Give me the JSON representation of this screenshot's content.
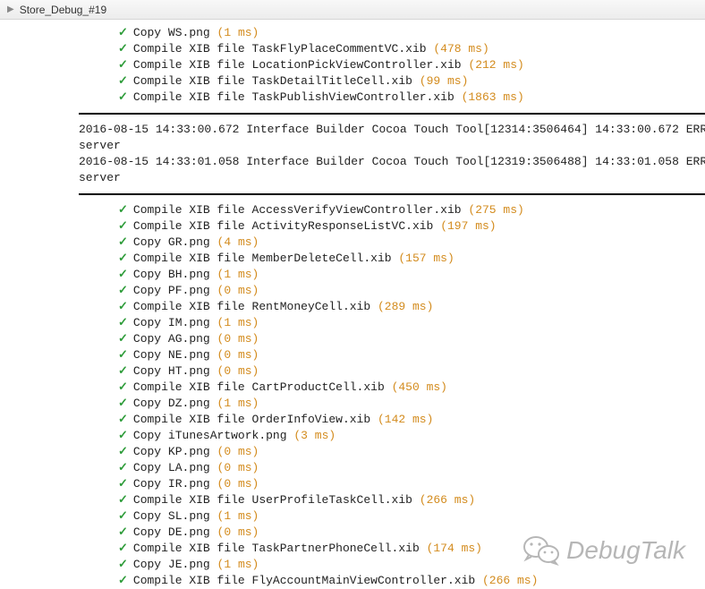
{
  "titlebar": {
    "title": "Store_Debug_#19"
  },
  "section1": [
    {
      "label": "Copy WS.png",
      "time": "(1 ms)"
    },
    {
      "label": "Compile XIB file TaskFlyPlaceCommentVC.xib",
      "time": "(478 ms)"
    },
    {
      "label": "Compile XIB file LocationPickViewController.xib",
      "time": "(212 ms)"
    },
    {
      "label": "Compile XIB file TaskDetailTitleCell.xib",
      "time": "(99 ms)"
    },
    {
      "label": "Compile XIB file TaskPublishViewController.xib",
      "time": "(1863 ms)"
    }
  ],
  "errors": [
    "2016-08-15 14:33:00.672 Interface Builder Cocoa Touch Tool[12314:3506464] 14:33:00.672 ERR",
    "server",
    "2016-08-15 14:33:01.058 Interface Builder Cocoa Touch Tool[12319:3506488] 14:33:01.058 ERR",
    "server"
  ],
  "section2": [
    {
      "label": "Compile XIB file AccessVerifyViewController.xib",
      "time": "(275 ms)"
    },
    {
      "label": "Compile XIB file ActivityResponseListVC.xib",
      "time": "(197 ms)"
    },
    {
      "label": "Copy GR.png",
      "time": "(4 ms)"
    },
    {
      "label": "Compile XIB file MemberDeleteCell.xib",
      "time": "(157 ms)"
    },
    {
      "label": "Copy BH.png",
      "time": "(1 ms)"
    },
    {
      "label": "Copy PF.png",
      "time": "(0 ms)"
    },
    {
      "label": "Compile XIB file RentMoneyCell.xib",
      "time": "(289 ms)"
    },
    {
      "label": "Copy IM.png",
      "time": "(1 ms)"
    },
    {
      "label": "Copy AG.png",
      "time": "(0 ms)"
    },
    {
      "label": "Copy NE.png",
      "time": "(0 ms)"
    },
    {
      "label": "Copy HT.png",
      "time": "(0 ms)"
    },
    {
      "label": "Compile XIB file CartProductCell.xib",
      "time": "(450 ms)"
    },
    {
      "label": "Copy DZ.png",
      "time": "(1 ms)"
    },
    {
      "label": "Compile XIB file OrderInfoView.xib",
      "time": "(142 ms)"
    },
    {
      "label": "Copy iTunesArtwork.png",
      "time": "(3 ms)"
    },
    {
      "label": "Copy KP.png",
      "time": "(0 ms)"
    },
    {
      "label": "Copy LA.png",
      "time": "(0 ms)"
    },
    {
      "label": "Copy IR.png",
      "time": "(0 ms)"
    },
    {
      "label": "Compile XIB file UserProfileTaskCell.xib",
      "time": "(266 ms)"
    },
    {
      "label": "Copy SL.png",
      "time": "(1 ms)"
    },
    {
      "label": "Copy DE.png",
      "time": "(0 ms)"
    },
    {
      "label": "Compile XIB file TaskPartnerPhoneCell.xib",
      "time": "(174 ms)"
    },
    {
      "label": "Copy JE.png",
      "time": "(1 ms)"
    },
    {
      "label": "Compile XIB file FlyAccountMainViewController.xib",
      "time": "(266 ms)"
    }
  ],
  "watermark": {
    "text": "DebugTalk"
  }
}
